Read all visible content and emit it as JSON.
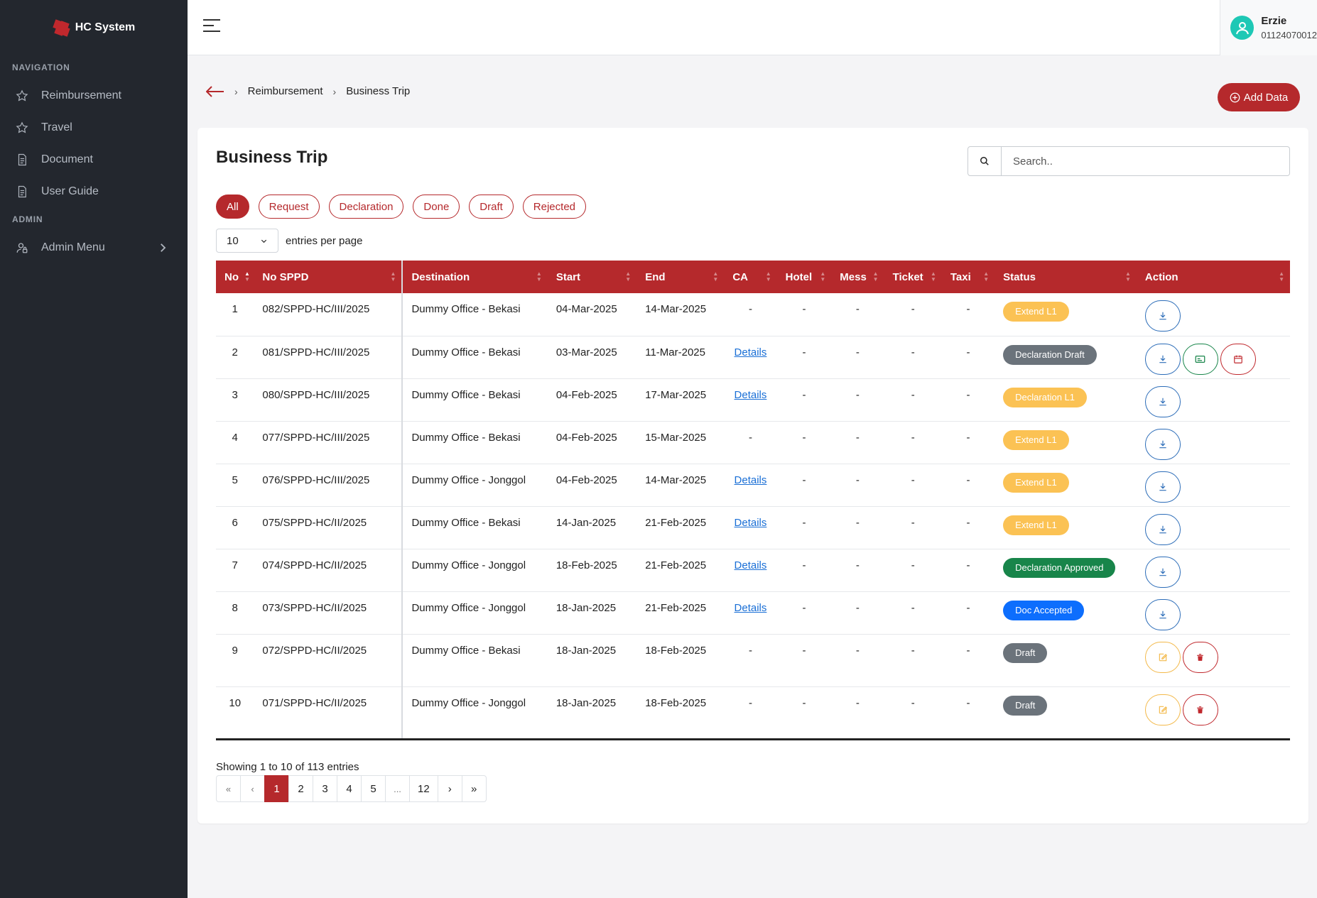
{
  "sidebar": {
    "brand": "HC System",
    "section_navigation": "NAVIGATION",
    "section_admin": "ADMIN",
    "items": [
      {
        "label": "Reimbursement",
        "icon": "star-icon"
      },
      {
        "label": "Travel",
        "icon": "star-icon"
      },
      {
        "label": "Document",
        "icon": "document-icon"
      },
      {
        "label": "User Guide",
        "icon": "document-icon"
      }
    ],
    "admin_item": {
      "label": "Admin Menu",
      "icon": "user-lock-icon"
    }
  },
  "user": {
    "name": "Erzie",
    "id": "01124070012"
  },
  "breadcrumb": {
    "items": [
      "Reimbursement",
      "Business Trip"
    ]
  },
  "add_button": "Add Data",
  "card": {
    "title": "Business Trip",
    "search_placeholder": "Search..",
    "filters": [
      "All",
      "Request",
      "Declaration",
      "Done",
      "Draft",
      "Rejected"
    ],
    "active_filter": "All",
    "entries_value": "10",
    "entries_label": "entries per page"
  },
  "table": {
    "columns": [
      "No",
      "No SPPD",
      "Destination",
      "Start",
      "End",
      "CA",
      "Hotel",
      "Mess",
      "Ticket",
      "Taxi",
      "Status",
      "Action"
    ],
    "rows": [
      {
        "no": "1",
        "sppd": "082/SPPD-HC/III/2025",
        "dest": "Dummy Office - Bekasi",
        "start": "04-Mar-2025",
        "end": "14-Mar-2025",
        "ca": "-",
        "hotel": "-",
        "mess": "-",
        "ticket": "-",
        "taxi": "-",
        "status": "Extend L1",
        "status_color": "yellow",
        "actions": [
          "download"
        ]
      },
      {
        "no": "2",
        "sppd": "081/SPPD-HC/III/2025",
        "dest": "Dummy Office - Bekasi",
        "start": "03-Mar-2025",
        "end": "11-Mar-2025",
        "ca": "Details",
        "hotel": "-",
        "mess": "-",
        "ticket": "-",
        "taxi": "-",
        "status": "Declaration Draft",
        "status_color": "gray",
        "actions": [
          "download",
          "card",
          "calendar"
        ]
      },
      {
        "no": "3",
        "sppd": "080/SPPD-HC/III/2025",
        "dest": "Dummy Office - Bekasi",
        "start": "04-Feb-2025",
        "end": "17-Mar-2025",
        "ca": "Details",
        "hotel": "-",
        "mess": "-",
        "ticket": "-",
        "taxi": "-",
        "status": "Declaration L1",
        "status_color": "yellow",
        "actions": [
          "download"
        ]
      },
      {
        "no": "4",
        "sppd": "077/SPPD-HC/III/2025",
        "dest": "Dummy Office - Bekasi",
        "start": "04-Feb-2025",
        "end": "15-Mar-2025",
        "ca": "-",
        "hotel": "-",
        "mess": "-",
        "ticket": "-",
        "taxi": "-",
        "status": "Extend L1",
        "status_color": "yellow",
        "actions": [
          "download"
        ]
      },
      {
        "no": "5",
        "sppd": "076/SPPD-HC/III/2025",
        "dest": "Dummy Office - Jonggol",
        "start": "04-Feb-2025",
        "end": "14-Mar-2025",
        "ca": "Details",
        "hotel": "-",
        "mess": "-",
        "ticket": "-",
        "taxi": "-",
        "status": "Extend L1",
        "status_color": "yellow",
        "actions": [
          "download"
        ]
      },
      {
        "no": "6",
        "sppd": "075/SPPD-HC/II/2025",
        "dest": "Dummy Office - Bekasi",
        "start": "14-Jan-2025",
        "end": "21-Feb-2025",
        "ca": "Details",
        "hotel": "-",
        "mess": "-",
        "ticket": "-",
        "taxi": "-",
        "status": "Extend L1",
        "status_color": "yellow",
        "actions": [
          "download"
        ]
      },
      {
        "no": "7",
        "sppd": "074/SPPD-HC/II/2025",
        "dest": "Dummy Office - Jonggol",
        "start": "18-Feb-2025",
        "end": "21-Feb-2025",
        "ca": "Details",
        "hotel": "-",
        "mess": "-",
        "ticket": "-",
        "taxi": "-",
        "status": "Declaration Approved",
        "status_color": "green",
        "actions": [
          "download"
        ]
      },
      {
        "no": "8",
        "sppd": "073/SPPD-HC/II/2025",
        "dest": "Dummy Office - Jonggol",
        "start": "18-Jan-2025",
        "end": "21-Feb-2025",
        "ca": "Details",
        "hotel": "-",
        "mess": "-",
        "ticket": "-",
        "taxi": "-",
        "status": "Doc Accepted",
        "status_color": "blue",
        "actions": [
          "download"
        ]
      },
      {
        "no": "9",
        "sppd": "072/SPPD-HC/II/2025",
        "dest": "Dummy Office - Bekasi",
        "start": "18-Jan-2025",
        "end": "18-Feb-2025",
        "ca": "-",
        "hotel": "-",
        "mess": "-",
        "ticket": "-",
        "taxi": "-",
        "status": "Draft",
        "status_color": "gray",
        "actions": [
          "edit",
          "delete"
        ]
      },
      {
        "no": "10",
        "sppd": "071/SPPD-HC/II/2025",
        "dest": "Dummy Office - Jonggol",
        "start": "18-Jan-2025",
        "end": "18-Feb-2025",
        "ca": "-",
        "hotel": "-",
        "mess": "-",
        "ticket": "-",
        "taxi": "-",
        "status": "Draft",
        "status_color": "gray",
        "actions": [
          "edit",
          "delete"
        ]
      }
    ]
  },
  "footer": {
    "showing": "Showing 1 to 10 of 113 entries",
    "pages": [
      "«",
      "‹",
      "1",
      "2",
      "3",
      "4",
      "5",
      "...",
      "12",
      "›",
      "»"
    ],
    "active_page": "1"
  },
  "colors": {
    "brand": "#b5292c",
    "sidebar": "#23272e",
    "yellow": "#fbc254",
    "gray": "#6b737b",
    "green": "#18854a",
    "blue": "#0d6efd"
  }
}
